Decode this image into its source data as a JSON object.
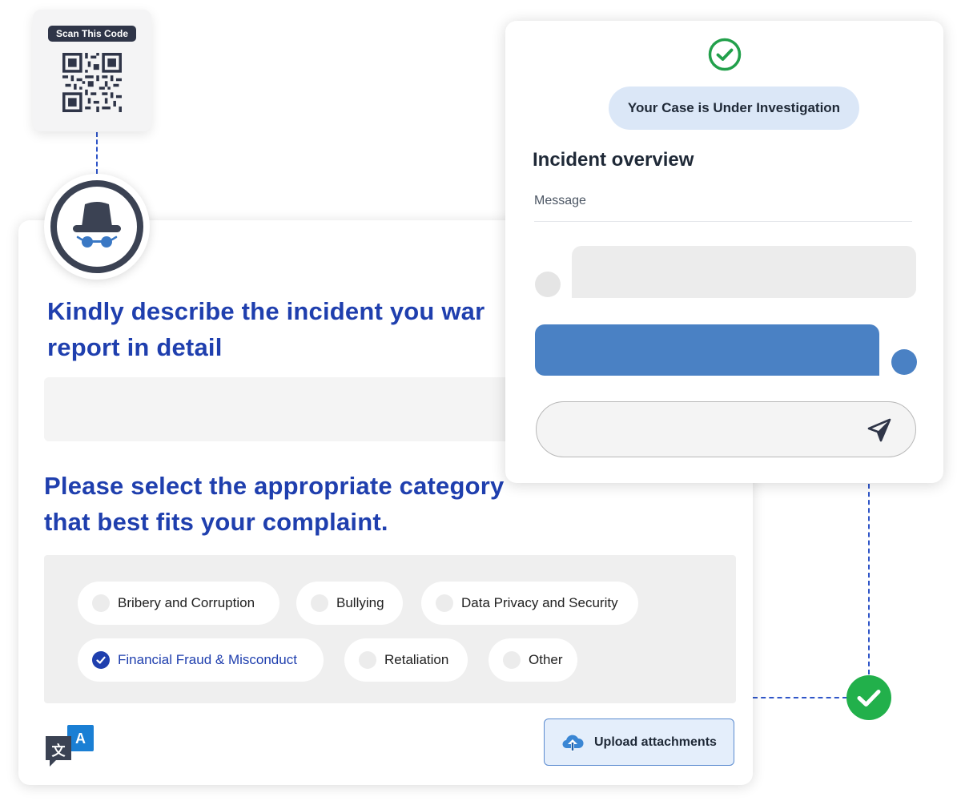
{
  "qr": {
    "badge_label": "Scan This Code"
  },
  "form": {
    "describe_heading_line1": "Kindly describe the incident you war",
    "describe_heading_line2": "report in detail",
    "category_heading_line1": "Please select the appropriate category",
    "category_heading_line2": "that best fits your complaint.",
    "categories": [
      {
        "label": "Bribery and Corruption",
        "selected": false
      },
      {
        "label": "Bullying",
        "selected": false
      },
      {
        "label": "Data Privacy and Security",
        "selected": false
      },
      {
        "label": "Financial Fraud & Misconduct",
        "selected": true
      },
      {
        "label": "Retaliation",
        "selected": false
      },
      {
        "label": "Other",
        "selected": false
      }
    ],
    "upload_label": "Upload attachments",
    "translate_icon_glyphs": {
      "source": "文",
      "target": "A"
    }
  },
  "status": {
    "pill_text": "Your Case is Under Investigation",
    "overview_title": "Incident overview",
    "message_label": "Message"
  },
  "colors": {
    "accent_blue": "#1f3fae",
    "chat_blue": "#4a81c4",
    "success_green": "#22b04b",
    "dark_slate": "#3b4253"
  }
}
